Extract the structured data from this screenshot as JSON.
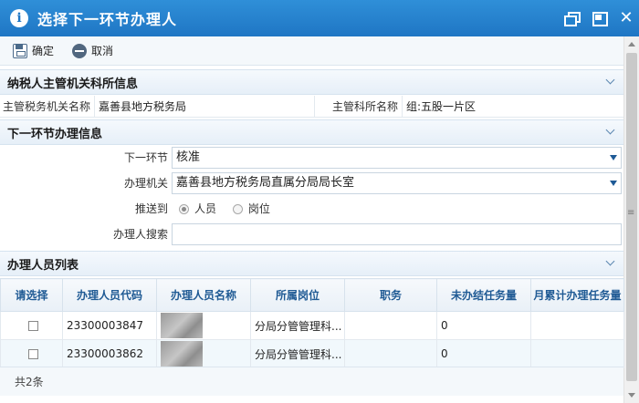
{
  "window": {
    "title": "选择下一环节办理人"
  },
  "toolbar": {
    "confirm_label": "确定",
    "cancel_label": "取消"
  },
  "section1": {
    "title": "纳税人主管机关科所信息",
    "authority_label": "主管税务机关名称",
    "authority_value": "嘉善县地方税务局",
    "dept_label": "主管科所名称",
    "dept_value": "组:五股一片区"
  },
  "section2": {
    "title": "下一环节办理信息",
    "next_step_label": "下一环节",
    "next_step_value": "核准",
    "office_label": "办理机关",
    "office_value": "嘉善县地方税务局直属分局局长室",
    "push_label": "推送到",
    "push_options": [
      "人员",
      "岗位"
    ],
    "search_label": "办理人搜索",
    "search_value": ""
  },
  "section3": {
    "title": "办理人员列表",
    "columns": [
      "请选择",
      "办理人员代码",
      "办理人员名称",
      "所属岗位",
      "职务",
      "未办结任务量",
      "月累计办理任务量"
    ],
    "rows": [
      {
        "code": "23300003847",
        "post": "分局分管管理科...",
        "duty": "",
        "pending": "0",
        "monthly": ""
      },
      {
        "code": "23300003862",
        "post": "分局分管管理科...",
        "duty": "",
        "pending": "0",
        "monthly": ""
      }
    ]
  },
  "footer": {
    "total": "共2条"
  }
}
